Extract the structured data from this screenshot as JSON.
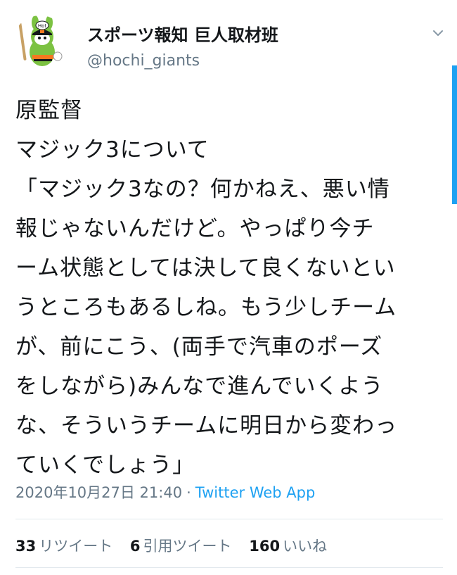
{
  "tweet": {
    "author": {
      "display_name": "スポーツ報知 巨人取材班",
      "handle": "@hochi_giants",
      "avatar_icon": "giants-mascot-icon",
      "avatar_badge_text": "Hot"
    },
    "menu_icon": "chevron-down-icon",
    "body_lines": [
      "原監督",
      "マジック3について",
      "「マジック3なの？何かねえ、悪い情",
      "報じゃないんだけど。やっぱり今チ",
      "ーム状態としては決して良くないとい",
      "うところもあるしね。もう少しチーム",
      "が、前にこう、(両手で汽車のポーズ",
      "をしながら)みんなで進んでいくよう",
      "な、そういうチームに明日から変わっ",
      "ていくでしょう」"
    ],
    "timestamp": "2020年10月27日 21:40",
    "separator": "·",
    "source": "Twitter Web App",
    "stats": {
      "retweets_count": "33",
      "retweets_label": "リツイート",
      "quotes_count": "6",
      "quotes_label": "引用ツイート",
      "likes_count": "160",
      "likes_label": "いいね"
    }
  },
  "colors": {
    "text": "#14171a",
    "secondary": "#657786",
    "link": "#1da1f2",
    "divider": "#e1e8ed",
    "mascot_green": "#7cc242"
  }
}
